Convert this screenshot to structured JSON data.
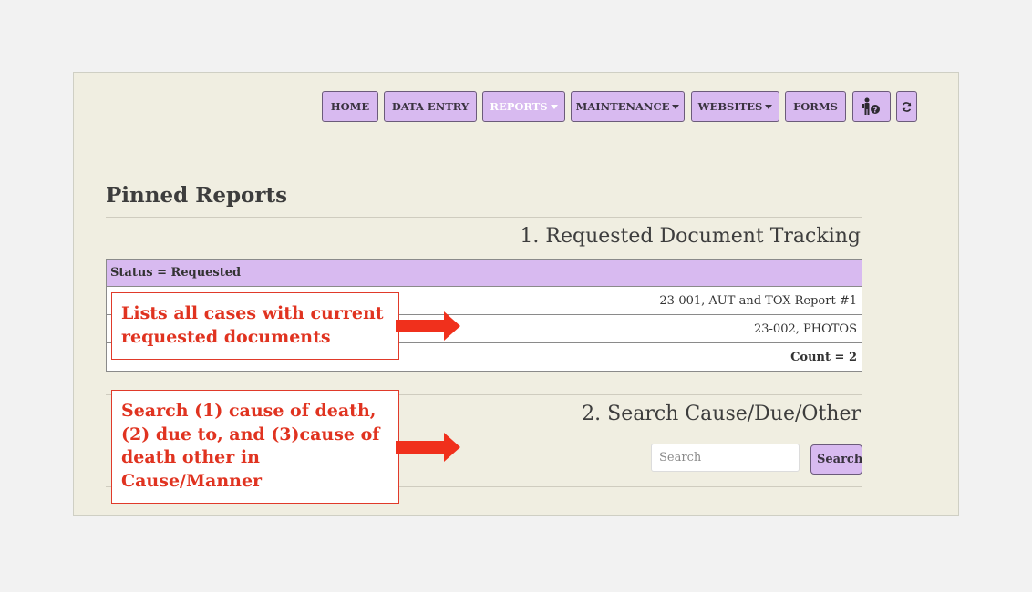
{
  "nav": {
    "home": "HOME",
    "data_entry": "DATA ENTRY",
    "reports": "REPORTS",
    "maintenance": "MAINTENANCE",
    "websites": "WEBSITES",
    "forms": "FORMS",
    "help_icon": "person-help-icon",
    "refresh_icon": "refresh-icon"
  },
  "page": {
    "heading": "Pinned Reports"
  },
  "section1": {
    "title": "1. Requested Document Tracking",
    "filter": "Status = Requested",
    "rows": [
      "23-001, AUT and TOX Report #1",
      "23-002, PHOTOS"
    ],
    "count": "Count = 2"
  },
  "section2": {
    "title": "2. Search Cause/Due/Other",
    "placeholder": "Search",
    "button": "Search"
  },
  "callouts": {
    "first": "Lists all cases with current requested documents",
    "second": "Search (1) cause of death, (2) due to, and (3)cause of death other in Cause/Manner"
  },
  "colors": {
    "nav_bg": "#d8baf0",
    "panel_bg": "#f0eee1",
    "callout_red": "#e03320"
  }
}
